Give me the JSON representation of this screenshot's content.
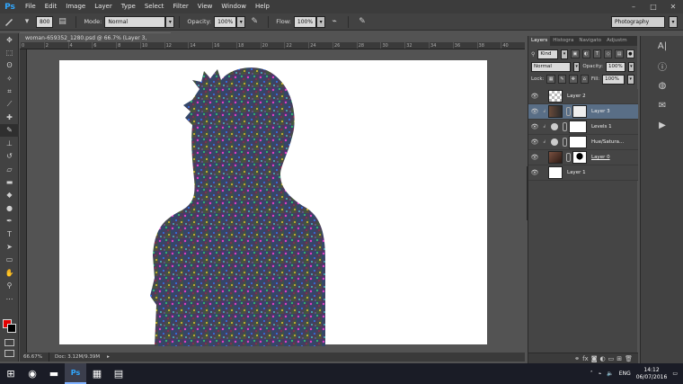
{
  "app": {
    "logo_text": "Ps",
    "menu": [
      "File",
      "Edit",
      "Image",
      "Layer",
      "Type",
      "Select",
      "Filter",
      "View",
      "Window",
      "Help"
    ],
    "window_controls": [
      "–",
      "□",
      "✕"
    ]
  },
  "options_bar": {
    "brush_size": "800",
    "mode_label": "Mode:",
    "mode_value": "Normal",
    "opacity_label": "Opacity:",
    "opacity_value": "100%",
    "flow_label": "Flow:",
    "flow_value": "100%",
    "workspace": "Photography"
  },
  "document": {
    "tab_title": "woman-659352_1280.psd @ 66.7% (Layer 3, RGB/8#) *",
    "tab_close": "×",
    "ruler_ticks": [
      "0",
      "2",
      "4",
      "6",
      "8",
      "10",
      "12",
      "14",
      "16",
      "18",
      "20",
      "22",
      "24",
      "26",
      "28",
      "30",
      "32",
      "34",
      "36",
      "38",
      "40"
    ],
    "zoom": "66.67%",
    "doc_size": "Doc: 3.12M/9.39M"
  },
  "layers_panel": {
    "tabs": [
      "Layers",
      "Histogra",
      "Navigato",
      "Adjustm"
    ],
    "filter_kind": "Kind",
    "blend_mode": "Normal",
    "opacity_label": "Opacity:",
    "opacity_value": "100%",
    "lock_label": "Lock:",
    "fill_label": "Fill:",
    "fill_value": "100%",
    "layers": [
      {
        "name": "Layer 2",
        "selected": false,
        "type": "transparent"
      },
      {
        "name": "Layer 3",
        "selected": true,
        "type": "photo-mask"
      },
      {
        "name": "Levels 1",
        "selected": false,
        "type": "adjustment"
      },
      {
        "name": "Hue/Satura...",
        "selected": false,
        "type": "adjustment"
      },
      {
        "name": "Layer 0",
        "selected": false,
        "type": "photo-silhouette"
      },
      {
        "name": "Layer 1",
        "selected": false,
        "type": "white"
      }
    ]
  },
  "taskbar": {
    "language": "ENG",
    "time": "14:12",
    "date": "06/07/2016"
  }
}
